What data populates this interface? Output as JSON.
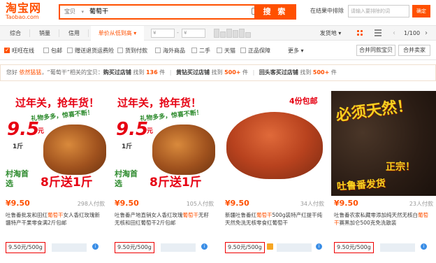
{
  "header": {
    "logo_text": "淘宝网",
    "logo_sub": "Taobao.com",
    "search_category": "宝贝",
    "search_query": "葡萄干",
    "search_button": "搜 索",
    "resort_label": "在结果中排除",
    "resort_placeholder": "请输入要排除的词",
    "resort_button": "确定"
  },
  "sortbar": {
    "items": [
      "综合",
      "销量",
      "信用",
      "单价从低到高",
      "发货地"
    ],
    "active": "单价从低到高",
    "price_from": "¥",
    "price_to": "¥",
    "page": "1/100"
  },
  "filters": {
    "checks": [
      "旺旺在线",
      "包邮",
      "赠送退货运费险",
      "货到付款",
      "海外商品",
      "二手",
      "天猫",
      "正品保障"
    ],
    "checked": [
      true,
      false,
      false,
      false,
      false,
      false,
      false,
      false
    ],
    "more": "更多",
    "btn_merge": "合并同款宝贝",
    "btn_shop": "合并卖家"
  },
  "notice": {
    "prefix": "您好",
    "user": "依然猛猛",
    "mid": "，“葡萄干”相关的宝贝：",
    "s1": "购买过店铺",
    "found": "找到",
    "n1": "136",
    "unit": "件",
    "s2": "黄钻买过店铺",
    "n2": "500+",
    "s3": "回头客买过店铺",
    "n3": "500+"
  },
  "products": [
    {
      "banner1": "过年关，抢年货！",
      "banner2": "礼物多多，惊喜不断！",
      "big_price": "9.5",
      "big_unit": "元",
      "small_unit": "1斤",
      "promo_left": "村淘首选",
      "promo": "8斤送1斤",
      "price": "¥9.50",
      "sold": "298人付款",
      "title_pre": "吐鲁番批发和田红",
      "title_kw": "葡萄干",
      "title_post": "女人香红玫瑰新疆特产干果零食满2斤包邮",
      "unit_price": "9.50元/500g"
    },
    {
      "banner1": "过年关，抢年货！",
      "banner2": "礼物多多，惊喜不断！",
      "big_price": "9.5",
      "big_unit": "元",
      "small_unit": "1斤",
      "promo_left": "村淘首选",
      "promo": "8斤送1斤",
      "price": "¥9.50",
      "sold": "105人付款",
      "title_pre": "吐鲁番产地直销女人香红玫瑰",
      "title_kw": "葡萄干",
      "title_post": "无籽无核和田红葡萄干2斤包邮",
      "unit_price": "9.50元/500g"
    },
    {
      "banner1": "4份包邮",
      "price": "¥9.50",
      "sold": "34人付款",
      "title_pre": "新疆吐鲁番红",
      "title_kw": "葡萄干",
      "title_post": "500g装特产红提干纯天然免洗无核零食红葡萄干",
      "unit_price": "9.50元/500g"
    },
    {
      "banner1": "必须天然！",
      "banner2": "正宗！",
      "banner3": "吐鲁番发货",
      "price": "¥9.50",
      "sold": "23人付款",
      "title_pre": "吐鲁番农家私藏零添加纯天然无核白",
      "title_kw": "葡萄干",
      "title_post": "赛黑加仑500克免洗散装",
      "unit_price": "9.50元/500g"
    }
  ],
  "colors": {
    "accent": "#ff5000",
    "highlight_border": "#ee0000",
    "badge_blue": "#3a8ee6"
  }
}
